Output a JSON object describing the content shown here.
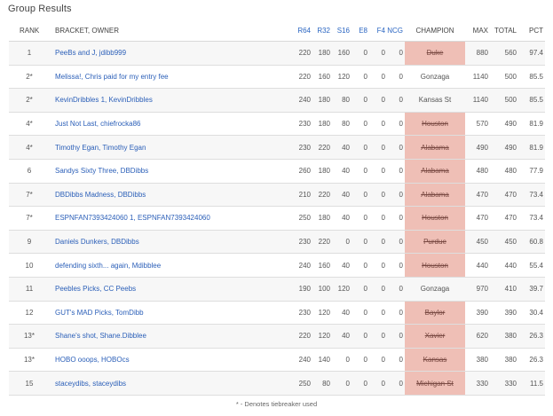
{
  "title": "Group Results",
  "columns": {
    "rank": "RANK",
    "bracket": "BRACKET, OWNER",
    "r64": "R64",
    "r32": "R32",
    "s16": "S16",
    "e8": "E8",
    "f4": "F4",
    "ncg": "NCG",
    "champion": "CHAMPION",
    "max": "MAX",
    "total": "TOTAL",
    "pct": "PCT"
  },
  "colors": {
    "eliminated_champion_bg": "#efbfb6",
    "link": "#2b5fb8",
    "round_header": "#2b66c2"
  },
  "rows": [
    {
      "rank": "1",
      "bracket": "PeeBs and J, jdibb999",
      "r64": "220",
      "r32": "180",
      "s16": "160",
      "e8": "0",
      "f4": "0",
      "ncg": "0",
      "champion": "Duke",
      "eliminated": true,
      "max": "880",
      "total": "560",
      "pct": "97.4"
    },
    {
      "rank": "2*",
      "bracket": "Melissa!, Chris paid for my entry fee",
      "r64": "220",
      "r32": "160",
      "s16": "120",
      "e8": "0",
      "f4": "0",
      "ncg": "0",
      "champion": "Gonzaga",
      "eliminated": false,
      "max": "1140",
      "total": "500",
      "pct": "85.5"
    },
    {
      "rank": "2*",
      "bracket": "KevinDribbles 1, KevinDribbles",
      "r64": "240",
      "r32": "180",
      "s16": "80",
      "e8": "0",
      "f4": "0",
      "ncg": "0",
      "champion": "Kansas St",
      "eliminated": false,
      "max": "1140",
      "total": "500",
      "pct": "85.5"
    },
    {
      "rank": "4*",
      "bracket": "Just Not Last, chiefrocka86",
      "r64": "230",
      "r32": "180",
      "s16": "80",
      "e8": "0",
      "f4": "0",
      "ncg": "0",
      "champion": "Houston",
      "eliminated": true,
      "max": "570",
      "total": "490",
      "pct": "81.9"
    },
    {
      "rank": "4*",
      "bracket": "Timothy Egan, Timothy Egan",
      "r64": "230",
      "r32": "220",
      "s16": "40",
      "e8": "0",
      "f4": "0",
      "ncg": "0",
      "champion": "Alabama",
      "eliminated": true,
      "max": "490",
      "total": "490",
      "pct": "81.9"
    },
    {
      "rank": "6",
      "bracket": "Sandys Sixty Three, DBDibbs",
      "r64": "260",
      "r32": "180",
      "s16": "40",
      "e8": "0",
      "f4": "0",
      "ncg": "0",
      "champion": "Alabama",
      "eliminated": true,
      "max": "480",
      "total": "480",
      "pct": "77.9"
    },
    {
      "rank": "7*",
      "bracket": "DBDibbs Madness, DBDibbs",
      "r64": "210",
      "r32": "220",
      "s16": "40",
      "e8": "0",
      "f4": "0",
      "ncg": "0",
      "champion": "Alabama",
      "eliminated": true,
      "max": "470",
      "total": "470",
      "pct": "73.4"
    },
    {
      "rank": "7*",
      "bracket": "ESPNFAN7393424060 1, ESPNFAN7393424060",
      "r64": "250",
      "r32": "180",
      "s16": "40",
      "e8": "0",
      "f4": "0",
      "ncg": "0",
      "champion": "Houston",
      "eliminated": true,
      "max": "470",
      "total": "470",
      "pct": "73.4"
    },
    {
      "rank": "9",
      "bracket": "Daniels Dunkers, DBDibbs",
      "r64": "230",
      "r32": "220",
      "s16": "0",
      "e8": "0",
      "f4": "0",
      "ncg": "0",
      "champion": "Purdue",
      "eliminated": true,
      "max": "450",
      "total": "450",
      "pct": "60.8"
    },
    {
      "rank": "10",
      "bracket": "defending sixth... again, Mdibblee",
      "r64": "240",
      "r32": "160",
      "s16": "40",
      "e8": "0",
      "f4": "0",
      "ncg": "0",
      "champion": "Houston",
      "eliminated": true,
      "max": "440",
      "total": "440",
      "pct": "55.4"
    },
    {
      "rank": "11",
      "bracket": "Peebles Picks, CC Peebs",
      "r64": "190",
      "r32": "100",
      "s16": "120",
      "e8": "0",
      "f4": "0",
      "ncg": "0",
      "champion": "Gonzaga",
      "eliminated": false,
      "max": "970",
      "total": "410",
      "pct": "39.7"
    },
    {
      "rank": "12",
      "bracket": "GUT's MAD Picks, TomDibb",
      "r64": "230",
      "r32": "120",
      "s16": "40",
      "e8": "0",
      "f4": "0",
      "ncg": "0",
      "champion": "Baylor",
      "eliminated": true,
      "max": "390",
      "total": "390",
      "pct": "30.4"
    },
    {
      "rank": "13*",
      "bracket": "Shane's shot, Shane.Dibblee",
      "r64": "220",
      "r32": "120",
      "s16": "40",
      "e8": "0",
      "f4": "0",
      "ncg": "0",
      "champion": "Xavier",
      "eliminated": true,
      "max": "620",
      "total": "380",
      "pct": "26.3"
    },
    {
      "rank": "13*",
      "bracket": "HOBO ooops, HOBOcs",
      "r64": "240",
      "r32": "140",
      "s16": "0",
      "e8": "0",
      "f4": "0",
      "ncg": "0",
      "champion": "Kansas",
      "eliminated": true,
      "max": "380",
      "total": "380",
      "pct": "26.3"
    },
    {
      "rank": "15",
      "bracket": "staceydibs, staceydibs",
      "r64": "250",
      "r32": "80",
      "s16": "0",
      "e8": "0",
      "f4": "0",
      "ncg": "0",
      "champion": "Michigan St",
      "eliminated": true,
      "max": "330",
      "total": "330",
      "pct": "11.5"
    }
  ],
  "footnote": "* - Denotes tiebreaker used"
}
